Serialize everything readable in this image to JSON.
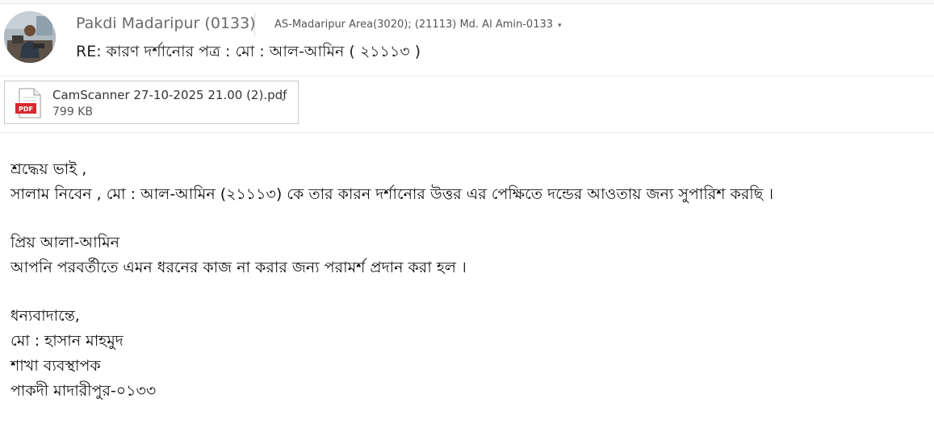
{
  "header": {
    "sender_name": "Pakdi Madaripur (0133)",
    "recipient": "AS-Madaripur Area(3020); (21113) Md. Al Amin-0133",
    "recipient_caret": "▾",
    "subject": "RE: কারণ দর্শানোর পত্র : মো : আল-আমিন ( ২১১১৩ )"
  },
  "attachment": {
    "icon_label": "PDF",
    "file_name": "CamScanner 27-10-2025 21.00 (2).pdf",
    "file_size": "799 KB",
    "caret": "⌄"
  },
  "body": {
    "greeting": "শ্রদ্ধেয় ভাই ,",
    "line1": "সালাম নিবেন , মো : আল-আমিন (২১১১৩) কে তার কারন দর্শানোর উত্তর এর পেক্ষিতে দন্ডের আওতায় জন্য সুপারিশ করছি ।",
    "salutation2": "প্রিয় আলা-আমিন",
    "line2": "আপনি পরবর্তীতে এমন ধরনের কাজ না করার জন্য পরামর্শ প্রদান করা হল ।",
    "closing": "ধন্যবাদান্তে,",
    "sig_name": "মো : হাসান মাহমুদ",
    "sig_title": "শাখা ব্যবস্থাপক",
    "sig_branch": "পাকদী মাদারীপুর-০১৩৩"
  },
  "colors": {
    "pdf_red": "#d9272e",
    "sender_gray": "#6a6a6a"
  }
}
